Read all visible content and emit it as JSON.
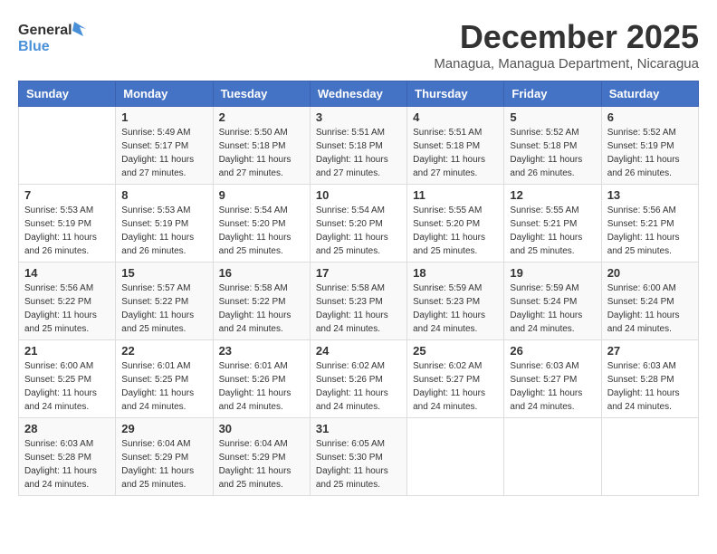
{
  "header": {
    "logo_general": "General",
    "logo_blue": "Blue",
    "main_title": "December 2025",
    "sub_title": "Managua, Managua Department, Nicaragua"
  },
  "calendar": {
    "days_of_week": [
      "Sunday",
      "Monday",
      "Tuesday",
      "Wednesday",
      "Thursday",
      "Friday",
      "Saturday"
    ],
    "weeks": [
      [
        {
          "day": "",
          "sunrise": "",
          "sunset": "",
          "daylight": ""
        },
        {
          "day": "1",
          "sunrise": "Sunrise: 5:49 AM",
          "sunset": "Sunset: 5:17 PM",
          "daylight": "Daylight: 11 hours and 27 minutes."
        },
        {
          "day": "2",
          "sunrise": "Sunrise: 5:50 AM",
          "sunset": "Sunset: 5:18 PM",
          "daylight": "Daylight: 11 hours and 27 minutes."
        },
        {
          "day": "3",
          "sunrise": "Sunrise: 5:51 AM",
          "sunset": "Sunset: 5:18 PM",
          "daylight": "Daylight: 11 hours and 27 minutes."
        },
        {
          "day": "4",
          "sunrise": "Sunrise: 5:51 AM",
          "sunset": "Sunset: 5:18 PM",
          "daylight": "Daylight: 11 hours and 27 minutes."
        },
        {
          "day": "5",
          "sunrise": "Sunrise: 5:52 AM",
          "sunset": "Sunset: 5:18 PM",
          "daylight": "Daylight: 11 hours and 26 minutes."
        },
        {
          "day": "6",
          "sunrise": "Sunrise: 5:52 AM",
          "sunset": "Sunset: 5:19 PM",
          "daylight": "Daylight: 11 hours and 26 minutes."
        }
      ],
      [
        {
          "day": "7",
          "sunrise": "Sunrise: 5:53 AM",
          "sunset": "Sunset: 5:19 PM",
          "daylight": "Daylight: 11 hours and 26 minutes."
        },
        {
          "day": "8",
          "sunrise": "Sunrise: 5:53 AM",
          "sunset": "Sunset: 5:19 PM",
          "daylight": "Daylight: 11 hours and 26 minutes."
        },
        {
          "day": "9",
          "sunrise": "Sunrise: 5:54 AM",
          "sunset": "Sunset: 5:20 PM",
          "daylight": "Daylight: 11 hours and 25 minutes."
        },
        {
          "day": "10",
          "sunrise": "Sunrise: 5:54 AM",
          "sunset": "Sunset: 5:20 PM",
          "daylight": "Daylight: 11 hours and 25 minutes."
        },
        {
          "day": "11",
          "sunrise": "Sunrise: 5:55 AM",
          "sunset": "Sunset: 5:20 PM",
          "daylight": "Daylight: 11 hours and 25 minutes."
        },
        {
          "day": "12",
          "sunrise": "Sunrise: 5:55 AM",
          "sunset": "Sunset: 5:21 PM",
          "daylight": "Daylight: 11 hours and 25 minutes."
        },
        {
          "day": "13",
          "sunrise": "Sunrise: 5:56 AM",
          "sunset": "Sunset: 5:21 PM",
          "daylight": "Daylight: 11 hours and 25 minutes."
        }
      ],
      [
        {
          "day": "14",
          "sunrise": "Sunrise: 5:56 AM",
          "sunset": "Sunset: 5:22 PM",
          "daylight": "Daylight: 11 hours and 25 minutes."
        },
        {
          "day": "15",
          "sunrise": "Sunrise: 5:57 AM",
          "sunset": "Sunset: 5:22 PM",
          "daylight": "Daylight: 11 hours and 25 minutes."
        },
        {
          "day": "16",
          "sunrise": "Sunrise: 5:58 AM",
          "sunset": "Sunset: 5:22 PM",
          "daylight": "Daylight: 11 hours and 24 minutes."
        },
        {
          "day": "17",
          "sunrise": "Sunrise: 5:58 AM",
          "sunset": "Sunset: 5:23 PM",
          "daylight": "Daylight: 11 hours and 24 minutes."
        },
        {
          "day": "18",
          "sunrise": "Sunrise: 5:59 AM",
          "sunset": "Sunset: 5:23 PM",
          "daylight": "Daylight: 11 hours and 24 minutes."
        },
        {
          "day": "19",
          "sunrise": "Sunrise: 5:59 AM",
          "sunset": "Sunset: 5:24 PM",
          "daylight": "Daylight: 11 hours and 24 minutes."
        },
        {
          "day": "20",
          "sunrise": "Sunrise: 6:00 AM",
          "sunset": "Sunset: 5:24 PM",
          "daylight": "Daylight: 11 hours and 24 minutes."
        }
      ],
      [
        {
          "day": "21",
          "sunrise": "Sunrise: 6:00 AM",
          "sunset": "Sunset: 5:25 PM",
          "daylight": "Daylight: 11 hours and 24 minutes."
        },
        {
          "day": "22",
          "sunrise": "Sunrise: 6:01 AM",
          "sunset": "Sunset: 5:25 PM",
          "daylight": "Daylight: 11 hours and 24 minutes."
        },
        {
          "day": "23",
          "sunrise": "Sunrise: 6:01 AM",
          "sunset": "Sunset: 5:26 PM",
          "daylight": "Daylight: 11 hours and 24 minutes."
        },
        {
          "day": "24",
          "sunrise": "Sunrise: 6:02 AM",
          "sunset": "Sunset: 5:26 PM",
          "daylight": "Daylight: 11 hours and 24 minutes."
        },
        {
          "day": "25",
          "sunrise": "Sunrise: 6:02 AM",
          "sunset": "Sunset: 5:27 PM",
          "daylight": "Daylight: 11 hours and 24 minutes."
        },
        {
          "day": "26",
          "sunrise": "Sunrise: 6:03 AM",
          "sunset": "Sunset: 5:27 PM",
          "daylight": "Daylight: 11 hours and 24 minutes."
        },
        {
          "day": "27",
          "sunrise": "Sunrise: 6:03 AM",
          "sunset": "Sunset: 5:28 PM",
          "daylight": "Daylight: 11 hours and 24 minutes."
        }
      ],
      [
        {
          "day": "28",
          "sunrise": "Sunrise: 6:03 AM",
          "sunset": "Sunset: 5:28 PM",
          "daylight": "Daylight: 11 hours and 24 minutes."
        },
        {
          "day": "29",
          "sunrise": "Sunrise: 6:04 AM",
          "sunset": "Sunset: 5:29 PM",
          "daylight": "Daylight: 11 hours and 25 minutes."
        },
        {
          "day": "30",
          "sunrise": "Sunrise: 6:04 AM",
          "sunset": "Sunset: 5:29 PM",
          "daylight": "Daylight: 11 hours and 25 minutes."
        },
        {
          "day": "31",
          "sunrise": "Sunrise: 6:05 AM",
          "sunset": "Sunset: 5:30 PM",
          "daylight": "Daylight: 11 hours and 25 minutes."
        },
        {
          "day": "",
          "sunrise": "",
          "sunset": "",
          "daylight": ""
        },
        {
          "day": "",
          "sunrise": "",
          "sunset": "",
          "daylight": ""
        },
        {
          "day": "",
          "sunrise": "",
          "sunset": "",
          "daylight": ""
        }
      ]
    ]
  }
}
